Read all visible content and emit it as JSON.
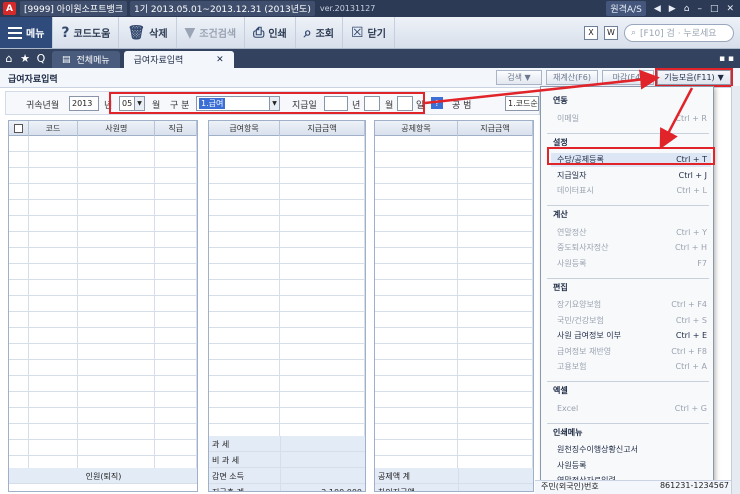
{
  "titlebar": {
    "app_letter": "A",
    "company": "[9999] 아이원소프트뱅크",
    "period": "1기 2013.05.01~2013.12.31 (2013년도)",
    "version": "ver.20131127",
    "remote": "원격A/S"
  },
  "toolbar": {
    "menu": "메뉴",
    "help": "코드도움",
    "delete": "삭제",
    "filter": "조건검색",
    "print": "인쇄",
    "search": "조회",
    "close": "닫기",
    "search_placeholder": "[F10] 검 · 누로세요"
  },
  "tabs": {
    "all_menu": "전체메뉴",
    "active": "급여자료입력"
  },
  "page": {
    "title": "급여자료입력",
    "buttons": [
      "검색 ▼",
      "재계산(F6)",
      "마감(F4)"
    ],
    "function_menu": "기능모음(F11)"
  },
  "filter": {
    "year_label": "귀속년월",
    "year": "2013",
    "year_unit": "년",
    "month": "05",
    "month_unit": "월",
    "kind_label": "구 분",
    "kind": "1.급여",
    "pay_label": "지급일",
    "pay_year_unit": "년",
    "pay_month_unit": "월",
    "pay_day_unit": "일",
    "pay_year": "",
    "pay_month": "",
    "pay_day": "",
    "right_label": "공 범",
    "right_value": "1.코드순"
  },
  "grid_emp": {
    "headers": [
      "코드",
      "사원명",
      "직급"
    ],
    "footer": "인원(퇴직)"
  },
  "grid_pay": {
    "headers": [
      "급여항목",
      "지급금액"
    ],
    "summary": [
      {
        "label": "과 세",
        "value": ""
      },
      {
        "label": "비 과 세",
        "value": ""
      },
      {
        "label": "감면 소득",
        "value": ""
      },
      {
        "label": "지급총 계",
        "value": "2,100,000"
      }
    ]
  },
  "grid_ded": {
    "headers": [
      "공제항목",
      "지급금액"
    ],
    "summary": [
      {
        "label": "공제액 계",
        "value": ""
      },
      {
        "label": "차인지급액",
        "value": ""
      }
    ]
  },
  "dropdown": {
    "sections": [
      {
        "title": "연동",
        "items": [
          {
            "label": "이메일",
            "key": "Ctrl + R",
            "enabled": false
          }
        ]
      },
      {
        "title": "설정",
        "items": [
          {
            "label": "수당/공제등록",
            "key": "Ctrl + T",
            "enabled": true,
            "highlight": true
          },
          {
            "label": "지급일자",
            "key": "Ctrl + J",
            "enabled": true
          },
          {
            "label": "데이터표시",
            "key": "Ctrl + L",
            "enabled": false
          }
        ]
      },
      {
        "title": "계산",
        "items": [
          {
            "label": "연말정산",
            "key": "Ctrl + Y",
            "enabled": false
          },
          {
            "label": "중도퇴사자정산",
            "key": "Ctrl + H",
            "enabled": false
          },
          {
            "label": "사원등록",
            "key": "F7",
            "enabled": false
          }
        ]
      },
      {
        "title": "편집",
        "items": [
          {
            "label": "장기요양보험",
            "key": "Ctrl + F4",
            "enabled": false
          },
          {
            "label": "국민/건강보험",
            "key": "Ctrl + S",
            "enabled": false
          },
          {
            "label": "사원 급여정보 이부",
            "key": "Ctrl + E",
            "enabled": true
          },
          {
            "label": "급여정보 재반영",
            "key": "Ctrl + F8",
            "enabled": false
          },
          {
            "label": "고용보험",
            "key": "Ctrl + A",
            "enabled": false
          }
        ]
      },
      {
        "title": "엑셀",
        "items": [
          {
            "label": "Excel",
            "key": "Ctrl + G",
            "enabled": false
          }
        ]
      },
      {
        "title": "인쇄메뉴",
        "items": [
          {
            "label": "원천징수이행상황신고서",
            "key": "",
            "enabled": true
          },
          {
            "label": "사원등록",
            "key": "",
            "enabled": true
          },
          {
            "label": "연말정산자료입력",
            "key": "",
            "enabled": true
          }
        ]
      }
    ]
  },
  "bottom": {
    "label": "주민(외국인)번호",
    "value": "861231-1234567"
  },
  "colors": {
    "highlight": "#e0242a",
    "selection": "#3b6fd6"
  }
}
